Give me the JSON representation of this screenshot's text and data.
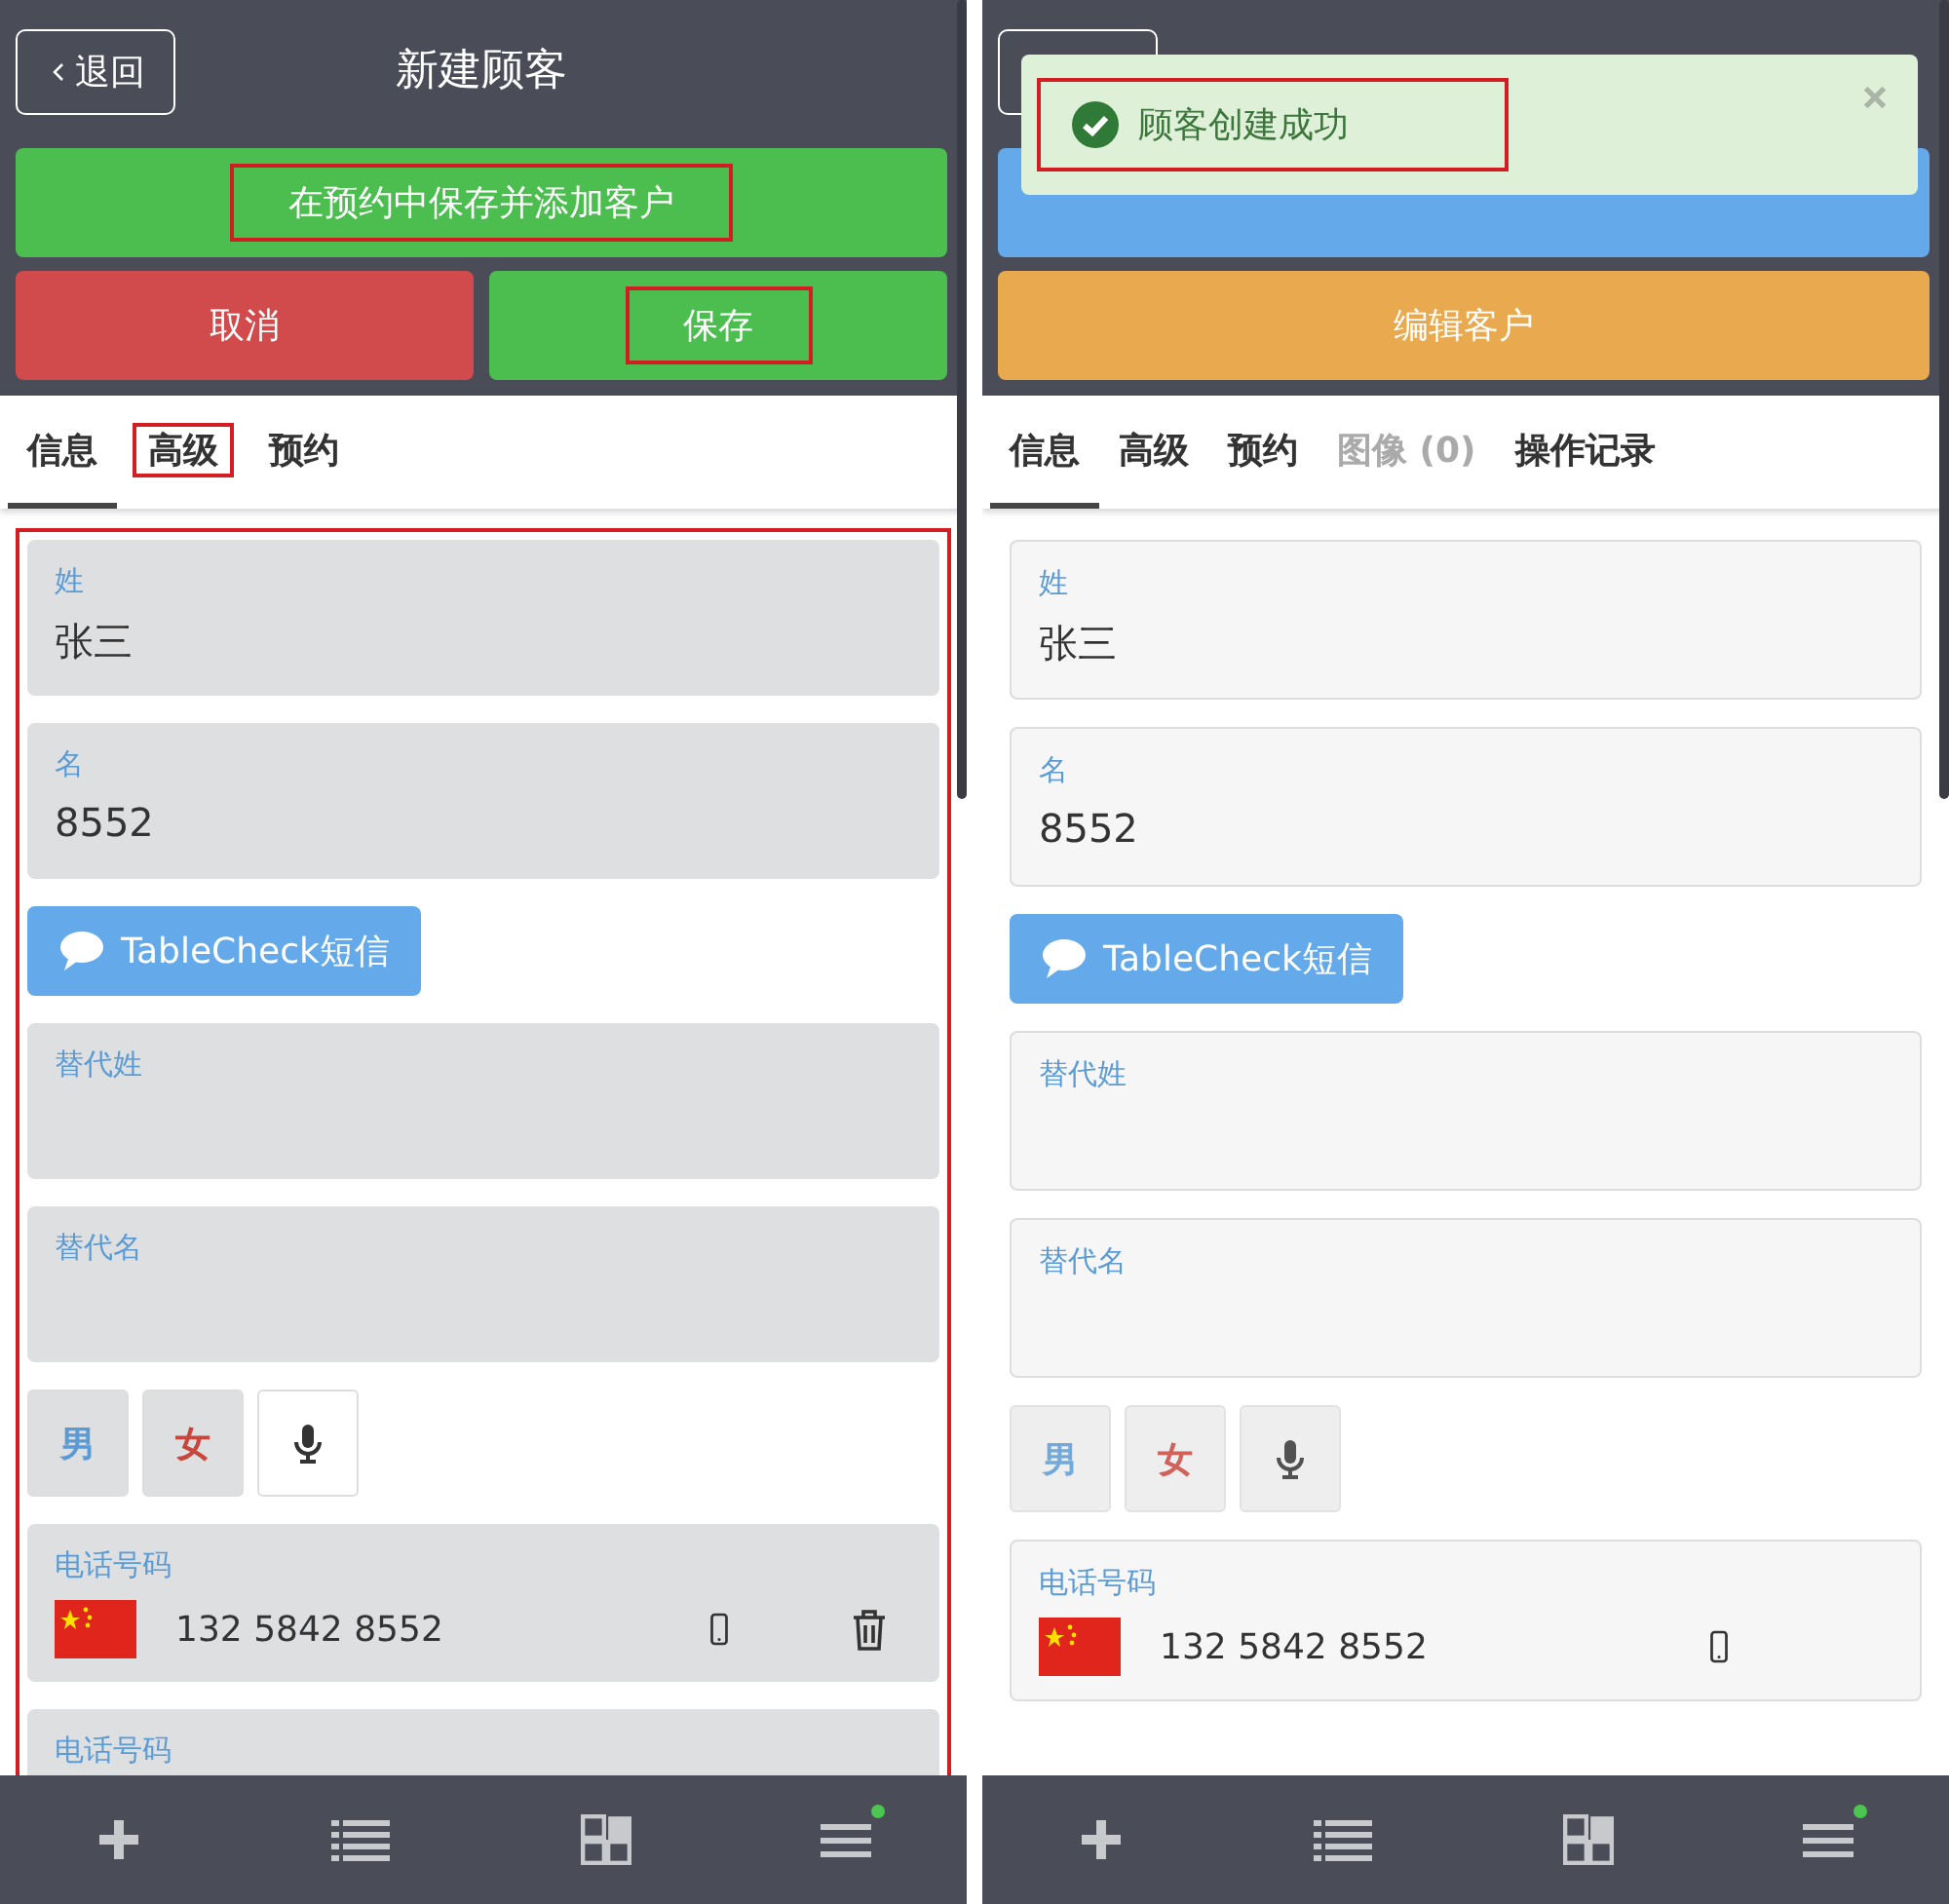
{
  "screens": [
    {
      "editing": true,
      "header": {
        "back": "退回",
        "title": "新建顾客"
      },
      "action_rows": [
        [
          {
            "label": "在预约中保存并添加客户",
            "kind": "green",
            "highlighted": true
          }
        ],
        [
          {
            "label": "取消",
            "kind": "red",
            "highlighted": false
          },
          {
            "label": "保存",
            "kind": "green",
            "highlighted": true
          }
        ]
      ],
      "tabs": [
        {
          "label": "信息",
          "selected": true,
          "highlighted": false,
          "disabled": false
        },
        {
          "label": "高级",
          "selected": false,
          "highlighted": true,
          "disabled": false
        },
        {
          "label": "预约",
          "selected": false,
          "highlighted": false,
          "disabled": false
        }
      ],
      "form_highlighted": true,
      "fields": [
        {
          "label": "姓",
          "value": "张三"
        },
        {
          "label": "名",
          "value": "8552"
        }
      ],
      "sms_button": "TableCheck短信",
      "alt_fields": [
        {
          "label": "替代姓"
        },
        {
          "label": "替代名"
        }
      ],
      "gender": [
        {
          "label": "男",
          "kind": "male"
        },
        {
          "label": "女",
          "kind": "female"
        }
      ],
      "phone": {
        "label": "电话号码",
        "number": "132 5842 8552",
        "deletable": true
      },
      "next_field": {
        "label": "电话号码"
      },
      "nav": {
        "menu_badge": true
      }
    },
    {
      "editing": false,
      "toast": {
        "text": "顾客创建成功",
        "highlighted": true
      },
      "action_rows": [
        [
          {
            "kind": "blue"
          }
        ],
        [
          {
            "label": "编辑客户",
            "kind": "orange",
            "highlighted": false
          }
        ]
      ],
      "tabs": [
        {
          "label": "信息",
          "selected": true,
          "highlighted": false,
          "disabled": false
        },
        {
          "label": "高级",
          "selected": false,
          "highlighted": false,
          "disabled": false
        },
        {
          "label": "预约",
          "selected": false,
          "highlighted": false,
          "disabled": false
        },
        {
          "label": "图像 (0)",
          "selected": false,
          "highlighted": false,
          "disabled": true
        },
        {
          "label": "操作记录",
          "selected": false,
          "highlighted": false,
          "disabled": false
        }
      ],
      "form_highlighted": false,
      "fields": [
        {
          "label": "姓",
          "value": "张三"
        },
        {
          "label": "名",
          "value": "8552"
        }
      ],
      "sms_button": "TableCheck短信",
      "alt_fields": [
        {
          "label": "替代姓"
        },
        {
          "label": "替代名"
        }
      ],
      "gender": [
        {
          "label": "男",
          "kind": "male"
        },
        {
          "label": "女",
          "kind": "female"
        }
      ],
      "phone": {
        "label": "电话号码",
        "number": "132 5842 8552",
        "deletable": false
      },
      "nav": {
        "menu_badge": true
      }
    }
  ]
}
